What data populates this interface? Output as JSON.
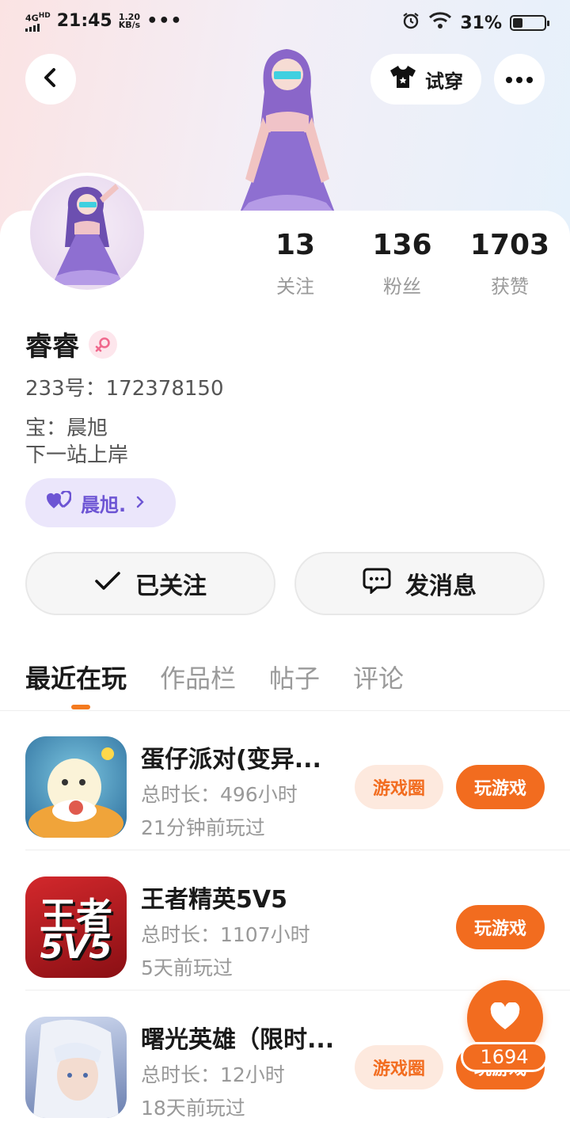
{
  "status": {
    "network": "4G",
    "network_sup": "HD",
    "speed_value": "1.20",
    "speed_unit": "KB/s",
    "time": "21:45",
    "dots": "•••",
    "battery": "31%",
    "battery_level": 0.31
  },
  "header": {
    "tryon_label": "试穿"
  },
  "profile": {
    "stats": [
      {
        "value": "13",
        "label": "关注"
      },
      {
        "value": "136",
        "label": "粉丝"
      },
      {
        "value": "1703",
        "label": "获赞"
      }
    ],
    "name": "睿睿",
    "id_line": "233号：172378150",
    "bio1": "宝：晨旭",
    "bio2": "下一站上岸",
    "badge_label": "晨旭."
  },
  "actions": {
    "follow_label": "已关注",
    "message_label": "发消息"
  },
  "tabs": [
    "最近在玩",
    "作品栏",
    "帖子",
    "评论"
  ],
  "games": [
    {
      "name": "蛋仔派对(变异...",
      "duration": "总时长：496小时",
      "last": "21分钟前玩过",
      "ring_label": "游戏圈",
      "play_label": "玩游戏"
    },
    {
      "name": "王者精英5V5",
      "duration": "总时长：1107小时",
      "last": "5天前玩过",
      "play_label": "玩游戏",
      "icon_text1": "王者",
      "icon_text2": "5V5"
    },
    {
      "name": "曙光英雄（限时...",
      "duration": "总时长：12小时",
      "last": "18天前玩过",
      "ring_label": "游戏圈",
      "play_label": "玩游戏"
    }
  ],
  "fab": {
    "count": "1694"
  },
  "colors": {
    "accent": "#f26c1f",
    "badge": "#6d55d4"
  }
}
